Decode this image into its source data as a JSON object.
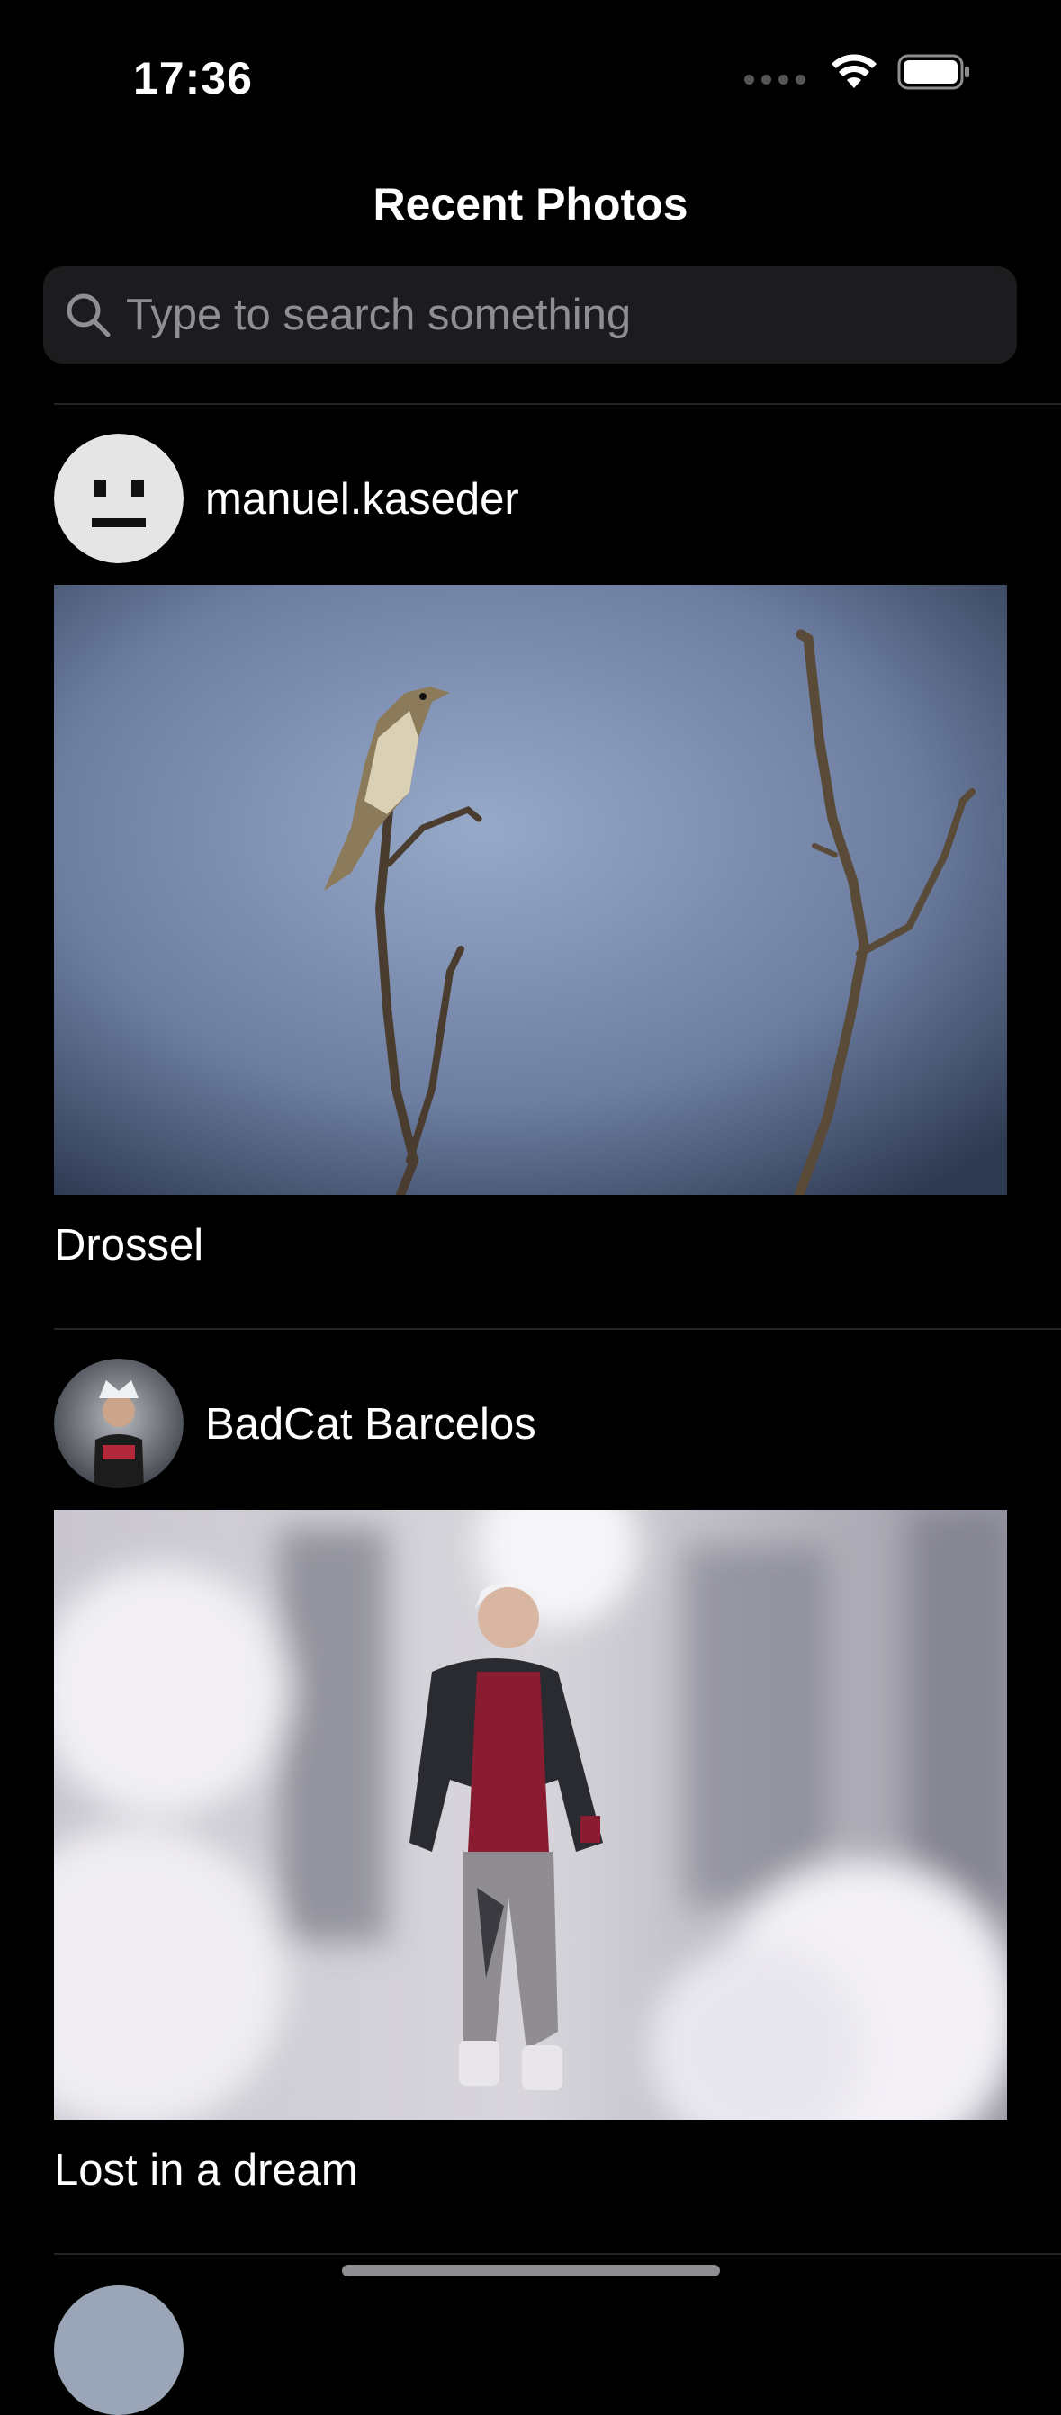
{
  "status_bar": {
    "time": "17:36",
    "icons": [
      "signal-dots-icon",
      "wifi-icon",
      "battery-icon"
    ]
  },
  "header": {
    "title": "Recent Photos"
  },
  "search": {
    "placeholder": "Type to search something",
    "value": "",
    "icon": "search-icon"
  },
  "posts": [
    {
      "username": "manuel.kaseder",
      "caption": "Drossel",
      "avatar": "neutral-face-avatar",
      "photo": "bird-on-branch-photo"
    },
    {
      "username": "BadCat Barcelos",
      "caption": "Lost in a dream",
      "avatar": "user-portrait-avatar",
      "photo": "person-in-winter-street-photo"
    }
  ],
  "colors": {
    "background": "#000000",
    "search_field": "#1c1c1e",
    "placeholder": "#8e8e93",
    "divider": "#242426"
  }
}
